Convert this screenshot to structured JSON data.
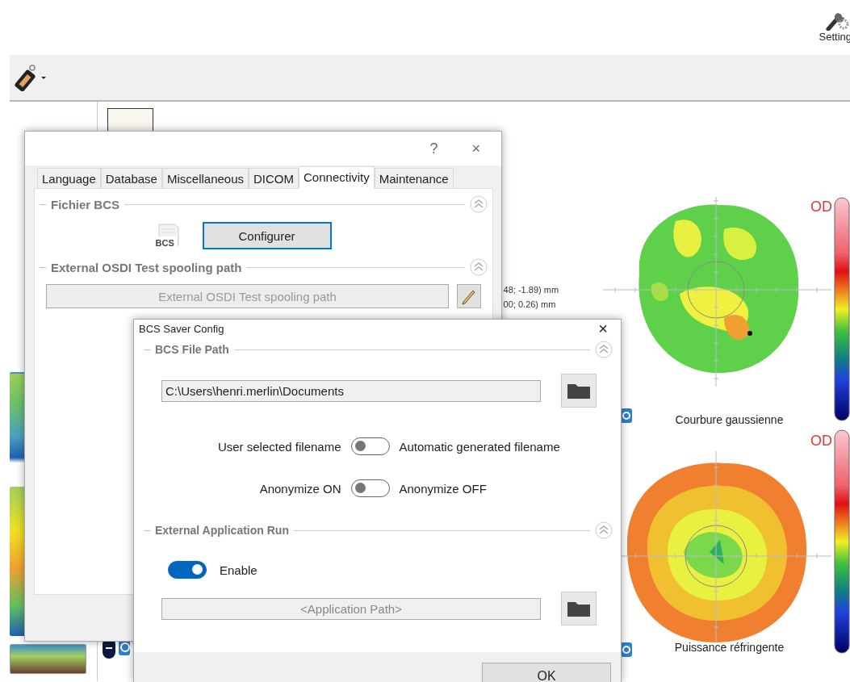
{
  "app": {
    "settings_button": {
      "label": "Setting"
    },
    "measurements": [
      "48; -1.89) mm",
      "00; 0.26) mm"
    ],
    "maps": [
      {
        "eye": "OD",
        "caption": "Courbure gaussienne",
        "kind": "curvature"
      },
      {
        "eye": "OD",
        "caption": "Puissance réfringente",
        "kind": "power"
      }
    ]
  },
  "settings_dialog": {
    "help": "?",
    "close": "×",
    "tabs": [
      {
        "label": "Language",
        "selected": false
      },
      {
        "label": "Database",
        "selected": false
      },
      {
        "label": "Miscellaneous",
        "selected": false
      },
      {
        "label": "DICOM",
        "selected": false
      },
      {
        "label": "Connectivity",
        "selected": true
      },
      {
        "label": "Maintenance",
        "selected": false
      }
    ],
    "sections": [
      {
        "title": "Fichier BCS",
        "kind": "button",
        "icon_label": "BCS",
        "button": "Configurer"
      },
      {
        "title": "External OSDI Test spooling path",
        "kind": "path",
        "placeholder": "External OSDI Test spooling path"
      }
    ]
  },
  "bcs_dialog": {
    "title": "BCS Saver Config",
    "close": "×",
    "file_section": {
      "title": "BCS File Path",
      "path": "C:\\Users\\henri.merlin\\Documents",
      "switches": [
        {
          "left": "User selected filename",
          "right": "Automatic generated filename",
          "on": false
        },
        {
          "left": "Anonymize ON",
          "right": "Anonymize OFF",
          "on": false
        }
      ]
    },
    "run_section": {
      "title": "External Application Run",
      "enable": {
        "label": "Enable",
        "on": true
      },
      "placeholder": "<Application Path>"
    },
    "ok": "OK"
  }
}
